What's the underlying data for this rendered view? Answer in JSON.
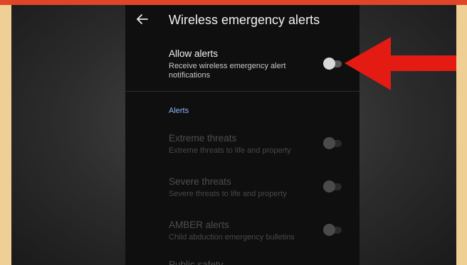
{
  "screen": {
    "title": "Wireless emergency alerts",
    "back_icon": "arrow-left-icon"
  },
  "allow_alerts": {
    "label": "Allow alerts",
    "description": "Receive wireless emergency alert notifications",
    "enabled": false
  },
  "alerts_section": {
    "header": "Alerts",
    "items": [
      {
        "label": "Extreme threats",
        "description": "Extreme threats to life and property",
        "enabled": false
      },
      {
        "label": "Severe threats",
        "description": "Severe threats to life and property",
        "enabled": false
      },
      {
        "label": "AMBER alerts",
        "description": "Child abduction emergency bulletins",
        "enabled": false
      }
    ],
    "next_item_label": "Public safety"
  },
  "colors": {
    "frame_border": "#efcf94",
    "top_stripe": "#e0452a",
    "phone_bg": "#0f0f10",
    "section_header": "#8ab4f8",
    "pointer_arrow": "#e31b13"
  }
}
